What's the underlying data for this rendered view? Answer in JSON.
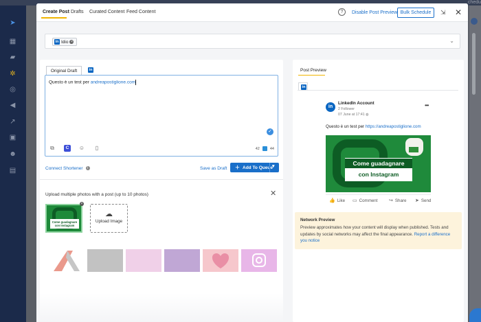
{
  "background_app": {
    "top_right_text": "chedu"
  },
  "header": {
    "tabs": [
      {
        "label": "Create Post",
        "active": true
      },
      {
        "label": "Drafts"
      },
      {
        "label": "Curated Content"
      },
      {
        "label": "Feed Content"
      }
    ],
    "disable_previews": "Disable Post Previews",
    "bulk_schedule": "Bulk Schedule"
  },
  "profiles": {
    "selected": [
      {
        "network": "linkedin",
        "badge": "in",
        "name": "Idio"
      }
    ]
  },
  "editor": {
    "tab_original": "Original Draft",
    "text_prefix": "Questo è un test per ",
    "text_url": "andreapostiglione.com",
    "counter_linkedin": "42",
    "counter_twitter": "44",
    "canva_label": "C"
  },
  "actions": {
    "connect_shortener": "Connect Shortener",
    "save_as_draft": "Save as Draft",
    "add_to_queue": "Add To Queue"
  },
  "upload": {
    "title": "Upload multiple photos with a post (up to 10 photos)",
    "upload_image_label": "Upload Image",
    "thumb_caption_line1": "Come guadagnare",
    "thumb_caption_line2": "con Instagram"
  },
  "preview": {
    "title": "Post Preview",
    "account_name": "LinkedIn Account",
    "followers": "2 Follower",
    "timestamp": "07 June at 17:41",
    "post_text_prefix": "Questo è un test per ",
    "post_text_url": "https://andreapostiglione.com",
    "image_caption_line1": "Come guadagnare",
    "image_caption_line2": "con Instagram",
    "actions": [
      "Like",
      "Comment",
      "Share",
      "Send"
    ]
  },
  "network_preview": {
    "title": "Network Preview",
    "body": "Preview approximates how your content will display when published. Tests and updates by social networks may affect the final appearance.",
    "link": "Report a difference you notice"
  },
  "colors": {
    "accent": "#1a6fc9",
    "tab_underline": "#f0b400",
    "linkedin": "#0a66c2",
    "notice_bg": "#fdf3dc"
  }
}
